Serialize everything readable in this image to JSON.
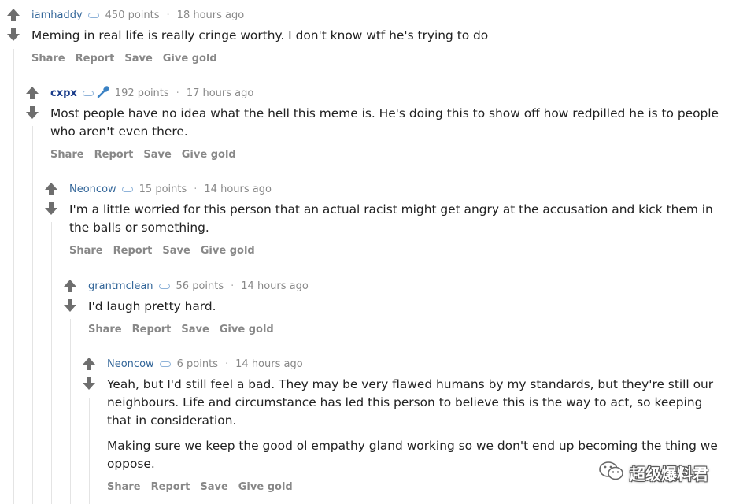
{
  "comments": [
    {
      "author": "iamhaddy",
      "points": "450 points",
      "time": "18 hours ago",
      "paragraphs": [
        "Meming in real life is really cringe worthy. I don't know wtf he's trying to do"
      ]
    },
    {
      "author": "cxpx",
      "points": "192 points",
      "time": "17 hours ago",
      "paragraphs": [
        "Most people have no idea what the hell this meme is. He's doing this to show off how redpilled he is to people who aren't even there."
      ]
    },
    {
      "author": "Neoncow",
      "points": "15 points",
      "time": "14 hours ago",
      "paragraphs": [
        "I'm a little worried for this person that an actual racist might get angry at the accusation and kick them in the balls or something."
      ]
    },
    {
      "author": "grantmclean",
      "points": "56 points",
      "time": "14 hours ago",
      "paragraphs": [
        "I'd laugh pretty hard."
      ]
    },
    {
      "author": "Neoncow",
      "points": "6 points",
      "time": "14 hours ago",
      "paragraphs": [
        "Yeah, but I'd still feel a bad. They may be very flawed humans by my standards, but they're still our neighbours. Life and circumstance has led this person to believe this is the way to act, so keeping that in consideration.",
        "Making sure we keep the good ol empathy gland working so we don't end up becoming the thing we oppose."
      ]
    }
  ],
  "buttons": {
    "share": "Share",
    "report": "Report",
    "save": "Save",
    "give_gold": "Give gold"
  },
  "separator": "·",
  "watermark": "超级爆料君",
  "colors": {
    "author": "#336699",
    "meta": "#888888",
    "vote_arrow": "#6e6e6e",
    "flair": "#8fb3d9",
    "thread_line": "#e4e4e4"
  },
  "icons": {
    "upvote": "arrow-up-icon",
    "downvote": "arrow-down-icon",
    "flair": "flair-icon",
    "mic": "microphone-icon",
    "watermark": "wechat-icon"
  }
}
